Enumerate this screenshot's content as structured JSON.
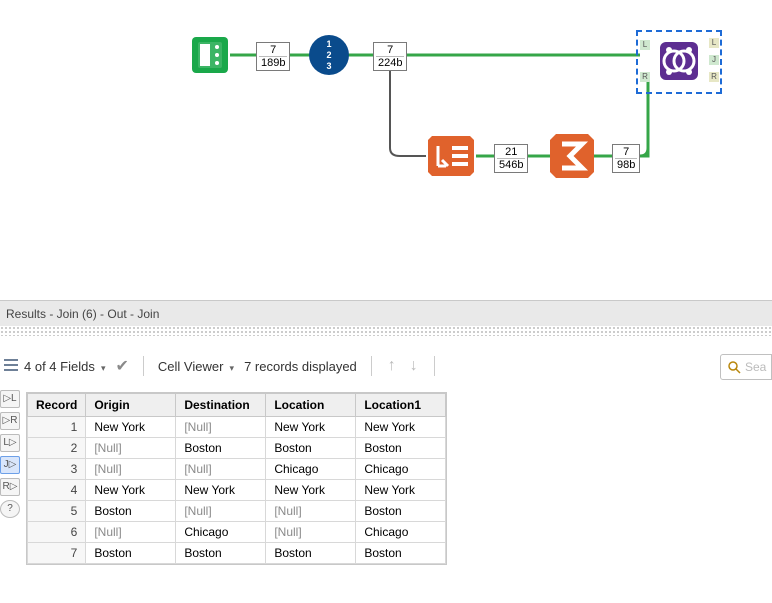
{
  "canvas": {
    "tools": {
      "input": {
        "records": "7",
        "size": "189b"
      },
      "recordid": {},
      "after_id": {
        "records": "7",
        "size": "224b"
      },
      "summarize": {
        "records": "21",
        "size": "546b"
      },
      "crosstab": {},
      "after_sum": {
        "records": "7",
        "size": "98b"
      },
      "join": {
        "port_L": "L",
        "port_J": "J",
        "port_R": "R"
      }
    }
  },
  "results": {
    "title": "Results - Join (6) - Out - Join",
    "fields_label": "4 of 4 Fields",
    "cell_viewer_label": "Cell Viewer",
    "records_label": "7 records displayed",
    "search_placeholder": "Sea"
  },
  "strip": {
    "b1": "▷L",
    "b2": "▷R",
    "b3": "L▷",
    "b4": "J▷",
    "b5": "R▷",
    "b6": "?"
  },
  "table": {
    "columns": {
      "c0": "Record",
      "c1": "Origin",
      "c2": "Destination",
      "c3": "Location",
      "c4": "Location1"
    },
    "rows": [
      {
        "n": "1",
        "origin": "New York",
        "dest": "[Null]",
        "loc": "New York",
        "loc1": "New York"
      },
      {
        "n": "2",
        "origin": "[Null]",
        "dest": "Boston",
        "loc": "Boston",
        "loc1": "Boston"
      },
      {
        "n": "3",
        "origin": "[Null]",
        "dest": "[Null]",
        "loc": "Chicago",
        "loc1": "Chicago"
      },
      {
        "n": "4",
        "origin": "New York",
        "dest": "New York",
        "loc": "New York",
        "loc1": "New York"
      },
      {
        "n": "5",
        "origin": "Boston",
        "dest": "[Null]",
        "loc": "[Null]",
        "loc1": "Boston"
      },
      {
        "n": "6",
        "origin": "[Null]",
        "dest": "Chicago",
        "loc": "[Null]",
        "loc1": "Chicago"
      },
      {
        "n": "7",
        "origin": "Boston",
        "dest": "Boston",
        "loc": "Boston",
        "loc1": "Boston"
      }
    ]
  }
}
